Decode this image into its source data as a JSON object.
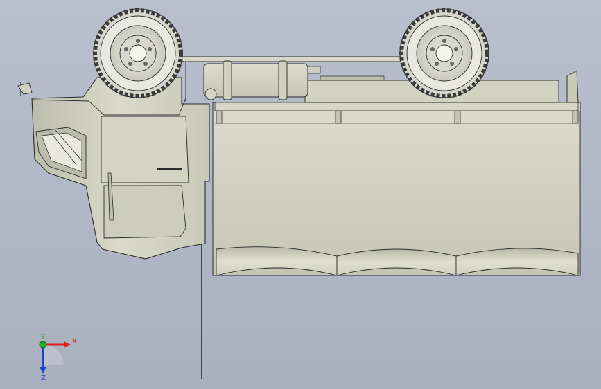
{
  "viewport": {
    "background_top": "#b9bfcd",
    "background_bottom": "#a8afbf"
  },
  "model": {
    "body_color": "#cfcfbf",
    "body_shadow": "#a9a99a",
    "line_color": "#2a2a2a",
    "tire_color": "#e4e4dc",
    "tire_tread_color": "#3a3a3a"
  },
  "triad": {
    "x_label": "X",
    "y_label": "Y",
    "z_label": "Z",
    "x_color": "#e02020",
    "y_color": "#20b020",
    "z_color": "#2040d0",
    "icons": [
      "x-axis-arrow-icon",
      "y-axis-dot-icon",
      "z-axis-arrow-icon"
    ]
  }
}
